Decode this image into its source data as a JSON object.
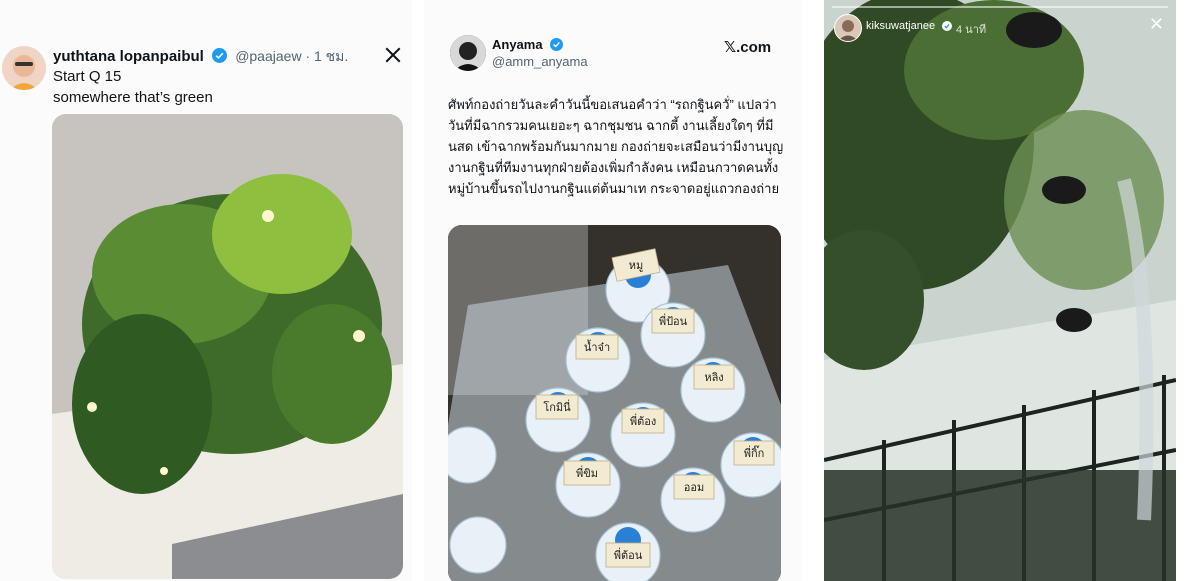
{
  "tweet1": {
    "display_name": "yuthtana lopanpaibul",
    "handle_time": "@paajaew · 1 ชม.",
    "lines": [
      "Start Q 15",
      "somewhere that’s green"
    ]
  },
  "tweet2": {
    "display_name": "Anyama",
    "handle": "@amm_anyama",
    "source": "𝕏.com",
    "body": "ศัพท์กองถ่ายวันละคำวันนี้ขอเสนอคำว่า “รถกฐินควั่” แปลว่า วันที่มีฉากรวมคนเยอะๆ ฉากชุมชน ฉากตี้ งานเลี้ยงใดๆ ที่มี นสด เข้าฉากพร้อมกันมากมาย กองถ่ายจะเสมือนว่ามีงานบุญงานกฐินที่ทีมงานทุกฝ่ายต้องเพิ่มกำลังคน เหมือนกวาดคนทั้งหมู่บ้านขึ้นรถไปงานกฐินแต่ต้นมาเท กระจาดอยู่แถวกองถ่าย",
    "bottle_labels": [
      "หมู",
      "พี่ป้อน",
      "น้ำจ๋า",
      "หลิง",
      "โกมินี่",
      "พี่ต้อง",
      "พี่กิ๊ก",
      "พี่ขิม",
      "ออม",
      "พี่ต้อน"
    ]
  },
  "story": {
    "username": "kiksuwatjanee",
    "time": "4 นาที"
  },
  "colors": {
    "verified": "#1d9bf0",
    "muted": "#536471"
  },
  "icons": [
    "x-logo-icon",
    "verified-badge-icon",
    "close-icon"
  ]
}
